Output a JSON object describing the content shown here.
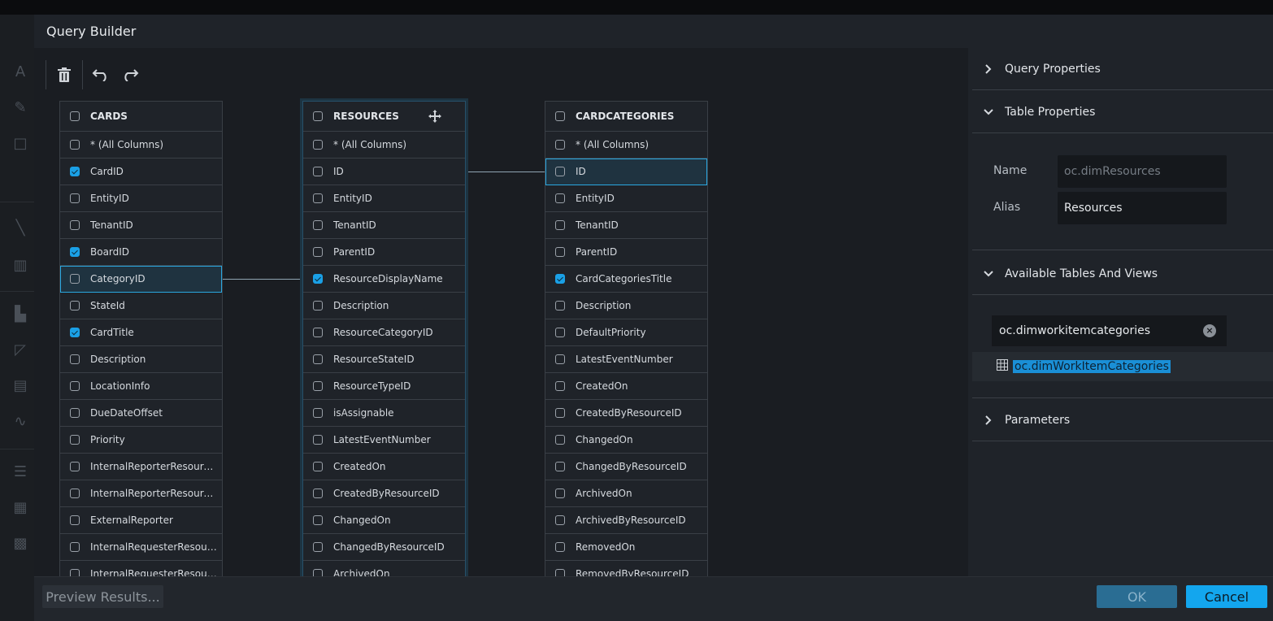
{
  "dialog": {
    "title": "Query Builder"
  },
  "toolbar": {
    "delete_icon": "trash-icon",
    "undo_icon": "undo-icon",
    "redo_icon": "redo-icon"
  },
  "tables": [
    {
      "name": "CARDS",
      "columns": [
        {
          "label": "* (All Columns)",
          "checked": false
        },
        {
          "label": "CardID",
          "checked": true
        },
        {
          "label": "EntityID",
          "checked": false
        },
        {
          "label": "TenantID",
          "checked": false
        },
        {
          "label": "BoardID",
          "checked": true
        },
        {
          "label": "CategoryID",
          "checked": false
        },
        {
          "label": "StateId",
          "checked": false
        },
        {
          "label": "CardTitle",
          "checked": true
        },
        {
          "label": "Description",
          "checked": false
        },
        {
          "label": "LocationInfo",
          "checked": false
        },
        {
          "label": "DueDateOffset",
          "checked": false
        },
        {
          "label": "Priority",
          "checked": false
        },
        {
          "label": "InternalReporterResourceID",
          "checked": false
        },
        {
          "label": "InternalReporterResourceC...",
          "checked": false
        },
        {
          "label": "ExternalReporter",
          "checked": false
        },
        {
          "label": "InternalRequesterResource...",
          "checked": false
        },
        {
          "label": "InternalRequesterResource...",
          "checked": false
        }
      ]
    },
    {
      "name": "RESOURCES",
      "columns": [
        {
          "label": "* (All Columns)",
          "checked": false
        },
        {
          "label": "ID",
          "checked": false
        },
        {
          "label": "EntityID",
          "checked": false
        },
        {
          "label": "TenantID",
          "checked": false
        },
        {
          "label": "ParentID",
          "checked": false
        },
        {
          "label": "ResourceDisplayName",
          "checked": true
        },
        {
          "label": "Description",
          "checked": false
        },
        {
          "label": "ResourceCategoryID",
          "checked": false
        },
        {
          "label": "ResourceStateID",
          "checked": false
        },
        {
          "label": "ResourceTypeID",
          "checked": false
        },
        {
          "label": "isAssignable",
          "checked": false
        },
        {
          "label": "LatestEventNumber",
          "checked": false
        },
        {
          "label": "CreatedOn",
          "checked": false
        },
        {
          "label": "CreatedByResourceID",
          "checked": false
        },
        {
          "label": "ChangedOn",
          "checked": false
        },
        {
          "label": "ChangedByResourceID",
          "checked": false
        },
        {
          "label": "ArchivedOn",
          "checked": false
        }
      ]
    },
    {
      "name": "CARDCATEGORIES",
      "columns": [
        {
          "label": "* (All Columns)",
          "checked": false
        },
        {
          "label": "ID",
          "checked": false
        },
        {
          "label": "EntityID",
          "checked": false
        },
        {
          "label": "TenantID",
          "checked": false
        },
        {
          "label": "ParentID",
          "checked": false
        },
        {
          "label": "CardCategoriesTitle",
          "checked": true
        },
        {
          "label": "Description",
          "checked": false
        },
        {
          "label": "DefaultPriority",
          "checked": false
        },
        {
          "label": "LatestEventNumber",
          "checked": false
        },
        {
          "label": "CreatedOn",
          "checked": false
        },
        {
          "label": "CreatedByResourceID",
          "checked": false
        },
        {
          "label": "ChangedOn",
          "checked": false
        },
        {
          "label": "ChangedByResourceID",
          "checked": false
        },
        {
          "label": "ArchivedOn",
          "checked": false
        },
        {
          "label": "ArchivedByResourceID",
          "checked": false
        },
        {
          "label": "RemovedOn",
          "checked": false
        },
        {
          "label": "RemovedByResourceID",
          "checked": false
        }
      ]
    }
  ],
  "panel": {
    "query_properties": "Query Properties",
    "table_properties": "Table Properties",
    "name_label": "Name",
    "name_value": "oc.dimResources",
    "alias_label": "Alias",
    "alias_value": "Resources",
    "available_tables": "Available Tables And Views",
    "search_value": "oc.dimworkitemcategories",
    "result": "oc.dimWorkItemCategories",
    "parameters": "Parameters"
  },
  "footer": {
    "preview": "Preview Results...",
    "ok": "OK",
    "cancel": "Cancel"
  },
  "colors": {
    "accent": "#13a6ee",
    "check": "#1aa0e6"
  }
}
